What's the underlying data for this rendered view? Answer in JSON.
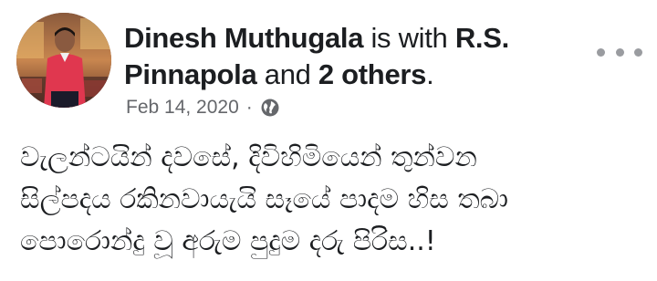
{
  "post": {
    "author": "Dinesh Muthugala",
    "with_text": " is with ",
    "tagged": "R.S. Pinnapola",
    "and_text": " and ",
    "others": "2 others",
    "period": ".",
    "date": "Feb 14, 2020",
    "separator": "·",
    "audience_icon": "globe-icon",
    "menu_icon": "more-options-icon",
    "body_lines": [
      "වැලන්ටයින් දවසේ, දිවිහිමියෙන් තුන්වන",
      "සිල්පදය රකිනවායැයි සෑයේ පාදම හිස තබා",
      "පොරොන්දු වූ අරුම පුදුම දරු පිරිස..!"
    ]
  },
  "colors": {
    "text_primary": "#1c1e21",
    "text_secondary": "#65676b",
    "background": "#ffffff"
  }
}
